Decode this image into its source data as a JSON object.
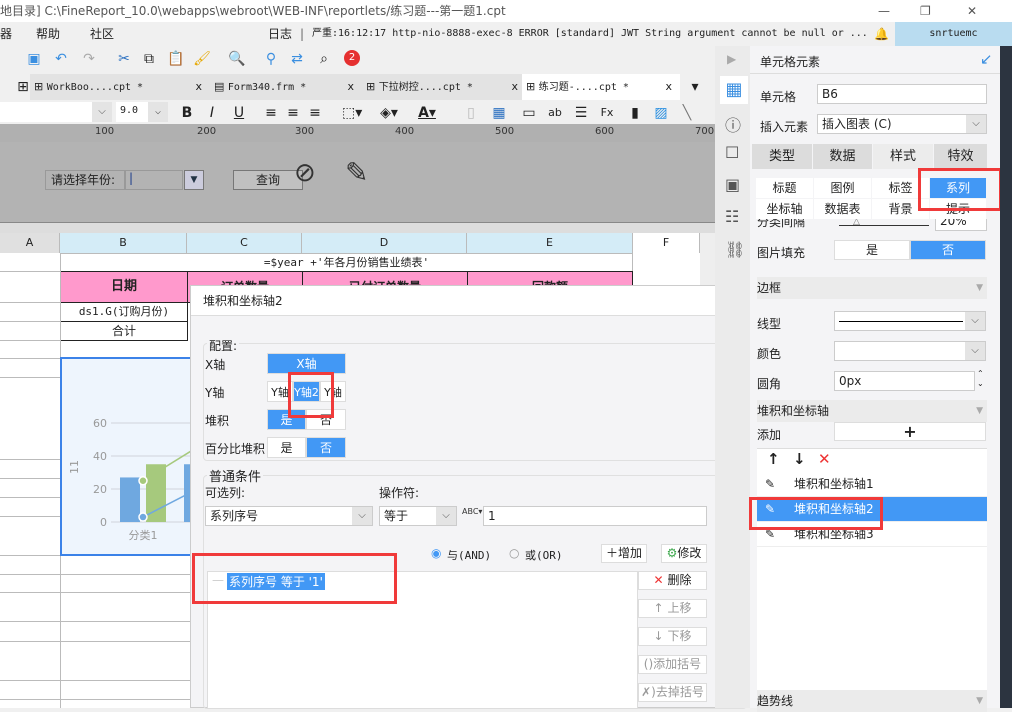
{
  "window": {
    "title": "地目录]   C:\\FineReport_10.0\\webapps\\webroot\\WEB-INF\\reportlets/练习题---第一题1.cpt",
    "min": "—",
    "max": "❐",
    "close": "✕"
  },
  "menu": {
    "items": [
      "器",
      "帮助",
      "社区"
    ],
    "log_label": "日志",
    "log_text": "严重:16:12:17 http-nio-8888-exec-8 ERROR [standard] JWT String argument cannot be null or ...",
    "user": "snrtuemc"
  },
  "toolbar": {
    "badge": "2"
  },
  "tabs": [
    {
      "label": "WorkBoo....cpt *"
    },
    {
      "label": "Form340.frm *"
    },
    {
      "label": "下拉树控....cpt *"
    },
    {
      "label": "练习题-....cpt *"
    }
  ],
  "format": {
    "font_size": "9.0"
  },
  "ruler": [
    "100",
    "200",
    "300",
    "400",
    "500",
    "600",
    "700"
  ],
  "param": {
    "label": "请选择年份:",
    "query": "查询"
  },
  "sheet": {
    "columns": [
      "A",
      "B",
      "C",
      "D",
      "E",
      "F"
    ],
    "title_formula": "=$year +'年各月份销售业绩表'",
    "header_b": "日期",
    "header_c": "订单数量",
    "header_d": "已付订单数量",
    "header_e": "回款额",
    "row_ds": "ds1.G(订购月份)",
    "row_total": "合计"
  },
  "chart_data": {
    "type": "bar",
    "categories": [
      "分类1"
    ],
    "ylabel": "11",
    "yticks": [
      "0",
      "20",
      "40",
      "60"
    ],
    "ylim": [
      0,
      70
    ],
    "series": [
      {
        "values": [
          27
        ],
        "color": "#6fa8e0"
      },
      {
        "values": [
          35
        ],
        "color": "#a6c97d"
      }
    ],
    "lines": [
      {
        "values": [
          3
        ],
        "color": "#6fa8e0"
      },
      {
        "values": [
          25
        ],
        "color": "#a6c97d"
      }
    ]
  },
  "dialog": {
    "title": "堆积和坐标轴2",
    "config_label": "配置:",
    "x_axis_label": "X轴",
    "x_axis_value": "X轴",
    "y_axis_label": "Y轴",
    "y_axis_options": [
      "Y轴",
      "Y轴2",
      "Y轴3"
    ],
    "y_axis_selected": 1,
    "stack_label": "堆积",
    "stack_options": [
      "是",
      "否"
    ],
    "stack_selected": 0,
    "percent_label": "百分比堆积",
    "percent_options": [
      "是",
      "否"
    ],
    "percent_selected": 1,
    "cond_label": "普通条件",
    "col_label": "可选列:",
    "col_value": "系列序号",
    "op_label": "操作符:",
    "op_value": "等于",
    "value": "1",
    "and_label": "与(AND)",
    "or_label": "或(OR)",
    "add": "增加",
    "modify": "修改",
    "conditions": [
      "系列序号 等于 '1'"
    ],
    "delete": "删除",
    "up": "上移",
    "down": "下移",
    "add_paren": "添加括号",
    "remove_paren": "去掉括号"
  },
  "panel": {
    "title": "单元格元素",
    "cell_label": "单元格",
    "cell_value": "B6",
    "insert_label": "插入元素",
    "insert_value": "插入图表 (C)",
    "tabs": [
      "类型",
      "数据",
      "样式",
      "特效"
    ],
    "subtabs": [
      "标题",
      "图例",
      "标签",
      "系列",
      "坐标轴",
      "数据表",
      "背景",
      "提示"
    ],
    "gap_label": "分类间隔",
    "gap_value": "20%",
    "imgfill_label": "图片填充",
    "imgfill_options": [
      "是",
      "否"
    ],
    "border_section": "边框",
    "line_label": "线型",
    "color_label": "颜色",
    "radius_label": "圆角",
    "radius_value": "0px",
    "stack_section": "堆积和坐标轴",
    "add_label": "添加",
    "add_btn": "+",
    "stack_items": [
      "堆积和坐标轴1",
      "堆积和坐标轴2",
      "堆积和坐标轴3"
    ],
    "stack_selected": 1,
    "trend_section": "趋势线"
  },
  "colors": {
    "accent": "#4298f5",
    "highlight": "#f03a3a",
    "header_pink": "#ff99cc"
  }
}
